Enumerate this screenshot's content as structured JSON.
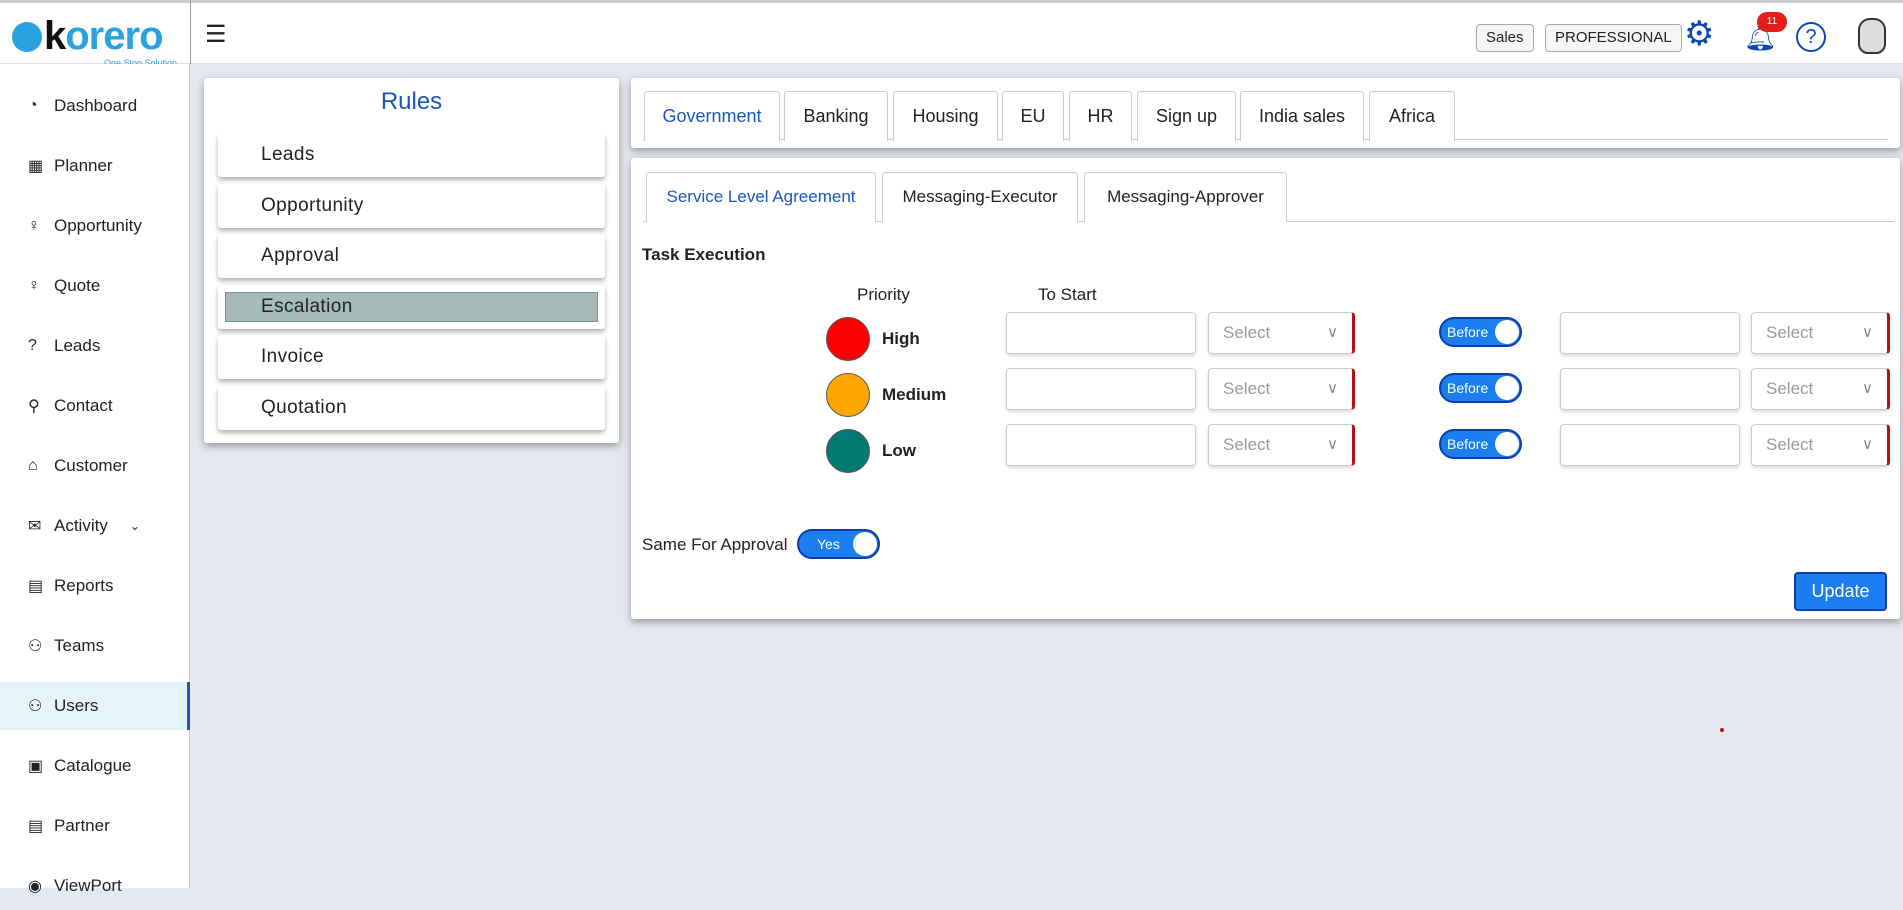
{
  "brand": {
    "name_k": "k",
    "name_rest": "orero",
    "tagline": "One Stop Solution"
  },
  "header": {
    "role_pill": "Sales",
    "plan_pill": "PROFESSIONAL",
    "notification_count": "11"
  },
  "sidebar": {
    "items": [
      {
        "label": "Dashboard",
        "icon": "dashboard-icon"
      },
      {
        "label": "Planner",
        "icon": "calendar-icon"
      },
      {
        "label": "Opportunity",
        "icon": "bulb-icon"
      },
      {
        "label": "Quote",
        "icon": "bulb-icon"
      },
      {
        "label": "Leads",
        "icon": "question-icon"
      },
      {
        "label": "Contact",
        "icon": "user-icon"
      },
      {
        "label": "Customer",
        "icon": "bank-icon"
      },
      {
        "label": "Activity",
        "icon": "mail-icon"
      },
      {
        "label": "Reports",
        "icon": "file-icon"
      },
      {
        "label": "Teams",
        "icon": "team-icon"
      },
      {
        "label": "Users",
        "icon": "users-icon",
        "active": true
      },
      {
        "label": "Catalogue",
        "icon": "grid-icon"
      },
      {
        "label": "Partner",
        "icon": "document-icon"
      },
      {
        "label": "ViewPort",
        "icon": "eye-icon"
      }
    ]
  },
  "rules": {
    "title": "Rules",
    "items": [
      "Leads",
      "Opportunity",
      "Approval",
      "Escalation",
      "Invoice",
      "Quotation"
    ],
    "active": "Escalation"
  },
  "tabs": [
    "Government",
    "Banking",
    "Housing",
    "EU",
    "HR",
    "Sign up",
    "India sales",
    "Africa"
  ],
  "subtabs": [
    "Service Level Agreement",
    "Messaging-Executor",
    "Messaging-Approver"
  ],
  "form": {
    "section": "Task Execution",
    "col_priority": "Priority",
    "col_to_start": "To Start",
    "rows": [
      {
        "priority": "High",
        "color": "#ff0000",
        "select1": "Select",
        "toggle": "Before",
        "select2": "Select"
      },
      {
        "priority": "Medium",
        "color": "#ffa500",
        "select1": "Select",
        "toggle": "Before",
        "select2": "Select"
      },
      {
        "priority": "Low",
        "color": "#007a73",
        "select1": "Select",
        "toggle": "Before",
        "select2": "Select"
      }
    ],
    "same_for_approval": "Same For Approval",
    "same_toggle": "Yes",
    "update": "Update"
  }
}
